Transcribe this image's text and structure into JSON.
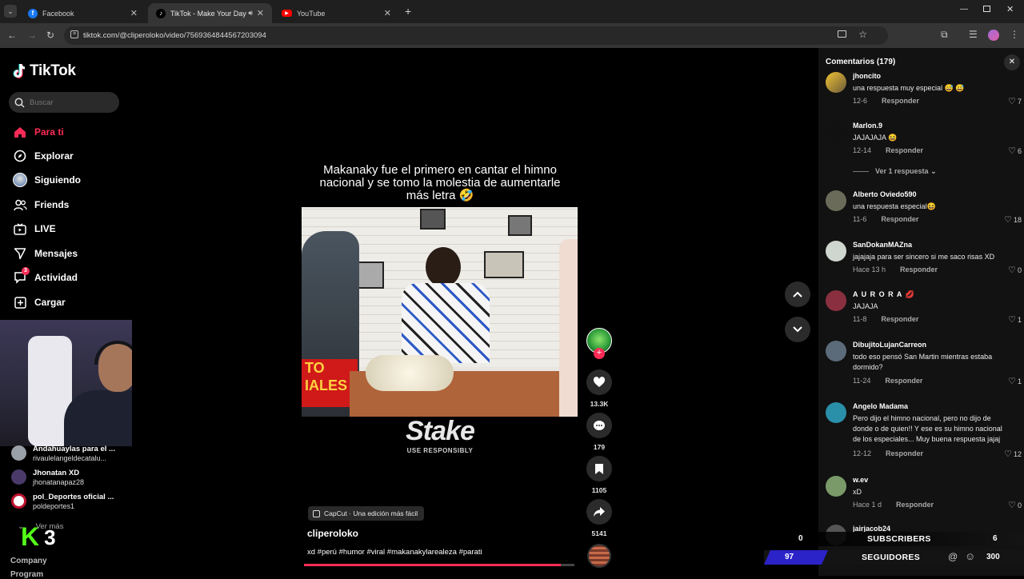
{
  "tabs": [
    {
      "title": "Facebook",
      "favicon": "facebook-icon",
      "color": "#1877f2",
      "active": false
    },
    {
      "title": "TikTok - Make Your Day",
      "favicon": "tiktok-icon",
      "color": "#000000",
      "active": true
    },
    {
      "title": "YouTube",
      "favicon": "youtube-icon",
      "color": "#ff0000",
      "active": false
    }
  ],
  "address": {
    "url": "tiktok.com/@cliperoloko/video/7569364844567203094"
  },
  "sidebar": {
    "logo": "TikTok",
    "search_placeholder": "Buscar",
    "items": [
      {
        "label": "Para ti",
        "icon": "home-icon",
        "active": true
      },
      {
        "label": "Explorar",
        "icon": "compass-icon"
      },
      {
        "label": "Siguiendo",
        "icon": "following-avatar-icon"
      },
      {
        "label": "Friends",
        "icon": "friends-icon"
      },
      {
        "label": "LIVE",
        "icon": "live-icon"
      },
      {
        "label": "Mensajes",
        "icon": "send-icon"
      },
      {
        "label": "Actividad",
        "icon": "activity-icon",
        "badge": "3"
      },
      {
        "label": "Cargar",
        "icon": "plus-square-icon"
      }
    ],
    "following": [
      {
        "name": "Andahuaylas para el ...",
        "handle": "rivaulelangeldecatalu..."
      },
      {
        "name": "Jhonatan XD",
        "handle": "jhonatanapaz28"
      },
      {
        "name": "pol_Deportes oficial ...",
        "handle": "poldeportes1"
      }
    ],
    "see_more": "Ver más",
    "footer": [
      "Company",
      "Program"
    ]
  },
  "video": {
    "caption": "Makanaky fue el primero en cantar el himno nacional y se tomo la molestia de aumentarle más letra 🤣",
    "watermark": "Stake",
    "watermark_sub": "USE RESPONSIBLY",
    "capcut": "CapCut · Una edición más fácil",
    "author": "cliperoloko",
    "description": "xd #perú #humor #viral #makanakylarealeza #parati",
    "progress": 0.95,
    "likes": "13.3K",
    "comments": "179",
    "saves": "1105",
    "shares": "5141"
  },
  "comments_panel": {
    "title": "Comentarios (179)",
    "items": [
      {
        "user": "jhoncito",
        "text": "una respuesta muy especial 😅 😅",
        "date": "12-6",
        "reply": "Responder",
        "likes": "7",
        "avatar": "#6a5a3a"
      },
      {
        "user": "Marlon.9",
        "text": "JAJAJAJA 😆",
        "date": "12-14",
        "reply": "Responder",
        "likes": "6",
        "avatar": "#111111",
        "sub": "Ver 1 respuesta"
      },
      {
        "user": "Alberto Oviedo590",
        "text": "una respuesta especial😆",
        "date": "11-6",
        "reply": "Responder",
        "likes": "18",
        "avatar": "#6b6b5a"
      },
      {
        "user": "SanDokanMAZna",
        "text": "jajajaja para ser sincero si me saco risas XD",
        "date": "Hace 13 h",
        "reply": "Responder",
        "likes": "0",
        "avatar": "#cfd6d0"
      },
      {
        "user": "A U R O R A 💋",
        "text": "JAJAJA",
        "date": "11-8",
        "reply": "Responder",
        "likes": "1",
        "avatar": "#8a2f3f"
      },
      {
        "user": "DibujitoLujanCarreon",
        "text": "todo eso pensó San Martin mientras estaba dormido?",
        "date": "11-24",
        "reply": "Responder",
        "likes": "1",
        "avatar": "#5c6b7a"
      },
      {
        "user": "Angelo Madama",
        "text": "Pero dijo el himno nacional, pero no dijo de donde o de quien!! Y ese es su himno nacional de los especiales... Muy buena respuesta jajaj",
        "date": "12-12",
        "reply": "Responder",
        "likes": "12",
        "avatar": "#2a8fa8"
      },
      {
        "user": "w.ev",
        "text": "xD",
        "date": "Hace 1 d",
        "reply": "Responder",
        "likes": "0",
        "avatar": "#7a9a6a"
      },
      {
        "user": "jairjacob24",
        "text": "",
        "date": "",
        "reply": "",
        "likes": "",
        "avatar": "#555555"
      }
    ]
  },
  "stream_overlay": {
    "logo_letter": "K",
    "logo_number": "3",
    "subscribers_label": "SUBSCRIBERS",
    "subscribers_left": "0",
    "subscribers_right": "6",
    "followers_label": "SEGUIDORES",
    "followers_left": "97",
    "followers_right": "300"
  }
}
